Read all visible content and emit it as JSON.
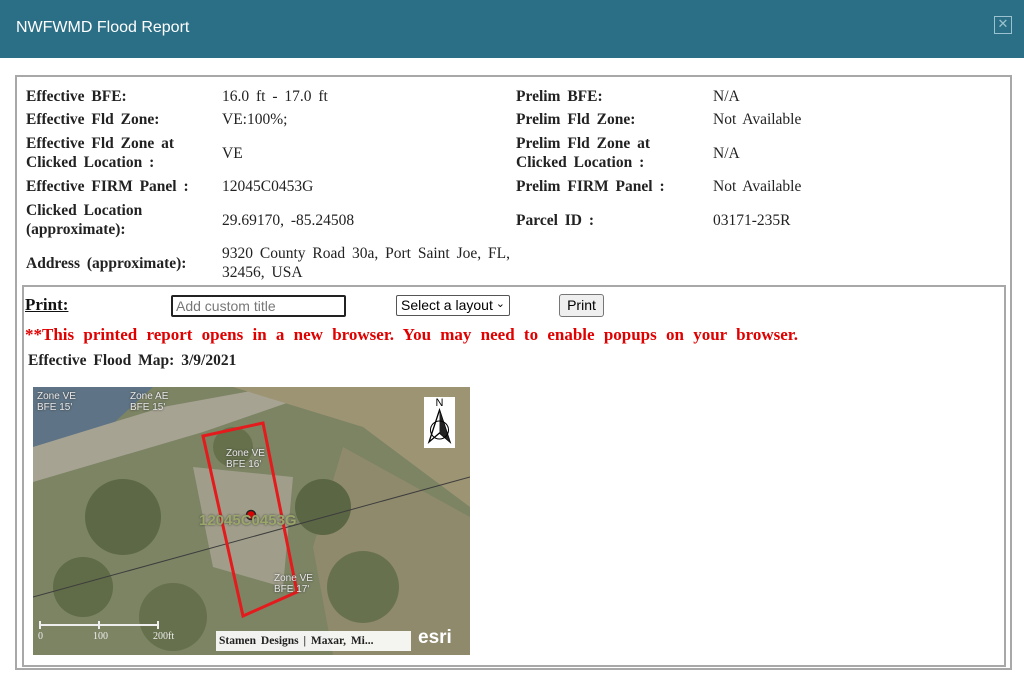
{
  "window": {
    "title": "NWFWMD Flood Report",
    "close_glyph": "✕"
  },
  "info": {
    "left": [
      {
        "label": "Effective BFE:",
        "value": "16.0 ft - 17.0 ft"
      },
      {
        "label": "Effective Fld Zone:",
        "value": "VE:100%;"
      },
      {
        "label": "Effective Fld Zone at Clicked Location :",
        "value": "VE"
      },
      {
        "label": "Effective FIRM Panel :",
        "value": "12045C0453G"
      },
      {
        "label": "Clicked Location (approximate):",
        "value": "29.69170, -85.24508"
      },
      {
        "label": "Address (approximate):",
        "value": "9320 County Road 30a, Port Saint Joe, FL, 32456, USA"
      }
    ],
    "right": [
      {
        "label": "Prelim BFE:",
        "value": "N/A"
      },
      {
        "label": "Prelim Fld Zone:",
        "value": "Not Available"
      },
      {
        "label": "Prelim Fld Zone at Clicked Location :",
        "value": "N/A"
      },
      {
        "label": "Prelim FIRM Panel :",
        "value": "Not Available"
      },
      {
        "label": "Parcel ID :",
        "value": "03171-235R"
      }
    ]
  },
  "print": {
    "label": "Print:",
    "title_placeholder": "Add custom title",
    "layout_select": "Select a layout",
    "button": "Print",
    "warning": "**This printed report opens in a new browser. You may need to enable popups on your browser."
  },
  "map": {
    "caption": "Effective Flood Map: 3/9/2021",
    "zone_labels": [
      {
        "zone": "Zone VE",
        "bfe": "BFE 15'"
      },
      {
        "zone": "Zone AE",
        "bfe": "BFE 15'"
      },
      {
        "zone": "Zone VE",
        "bfe": "BFE 16'"
      },
      {
        "zone": "Zone VE",
        "bfe": "BFE 17'"
      }
    ],
    "panel_id": "12045C0453G",
    "north": "N",
    "scale_labels": [
      "0",
      "100",
      "200ft"
    ],
    "attribution": "Stamen Designs | Maxar, Mi...",
    "logo": "esri",
    "colors": {
      "parcel_outline": "#e41a1c",
      "marker": "#e00000"
    }
  }
}
